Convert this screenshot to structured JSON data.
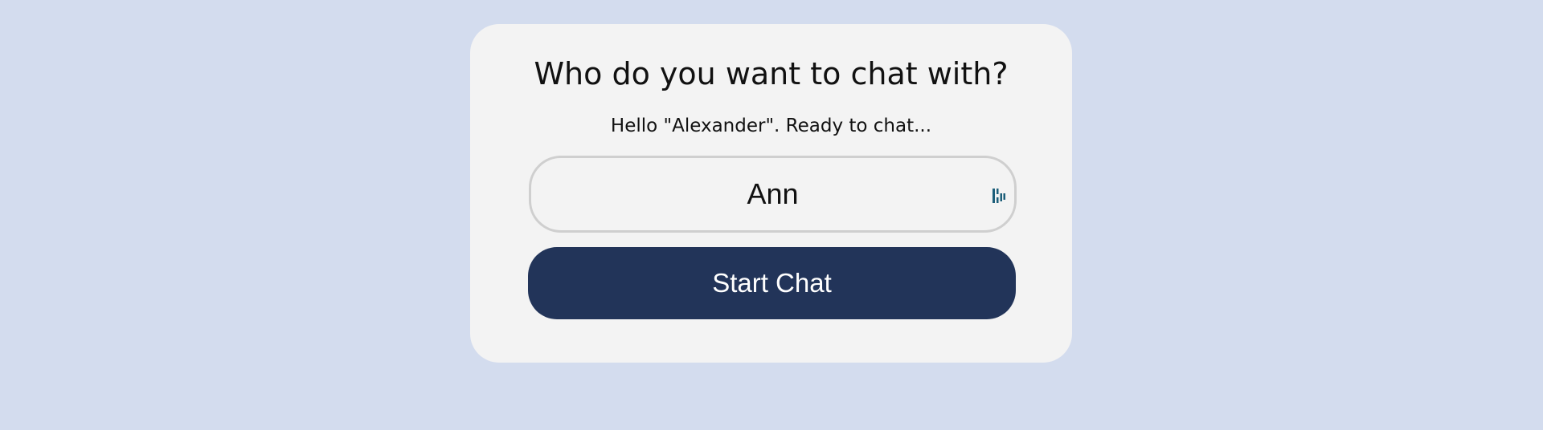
{
  "dialog": {
    "title": "Who do you want to chat with?",
    "greeting": "Hello \"Alexander\". Ready to chat..."
  },
  "recipient_input": {
    "value": "Ann",
    "icon": "password-manager-icon"
  },
  "start_button": {
    "label": "Start Chat"
  },
  "colors": {
    "background": "#d3dcee",
    "card": "#f3f3f3",
    "button": "#223459",
    "button_text": "#ffffff",
    "icon": "#1d5f7a"
  }
}
